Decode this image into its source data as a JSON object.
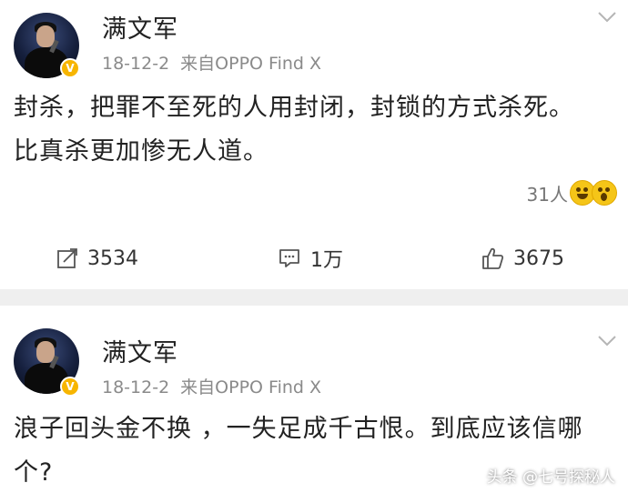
{
  "post1": {
    "username": "满文军",
    "date": "18-12-2",
    "source": "来自OPPO Find X",
    "content_line1": "封杀，把罪不至死的人用封闭，封锁的方式杀死。",
    "content_line2": "比真杀更加惨无人道。",
    "reaction_count": "31人",
    "actions": {
      "repost": "3534",
      "comment": "1万",
      "like": "3675"
    }
  },
  "post2": {
    "username": "满文军",
    "date": "18-12-2",
    "source": "来自OPPO Find X",
    "content_line1": "浪子回头金不换 ，一失足成千古恨。到底应该信哪",
    "content_line2": "个?"
  },
  "watermark": "头条 @七号探秘人",
  "colors": {
    "verified_badge": "#f7b500",
    "meta_gray": "#8a8a8a",
    "divider": "#efefef"
  },
  "icons": [
    "avatar",
    "verified-badge-icon",
    "chevron-down-icon",
    "repost-icon",
    "comment-icon",
    "like-icon",
    "laugh-emoji-icon",
    "surprised-emoji-icon"
  ]
}
